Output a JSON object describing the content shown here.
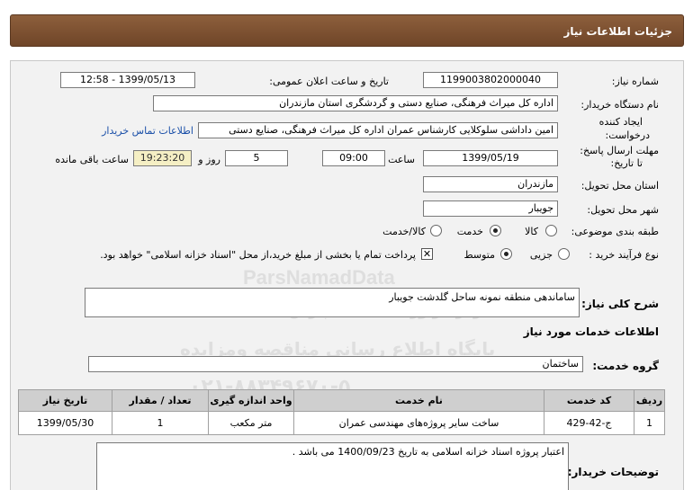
{
  "header": {
    "title": "جزئیات اطلاعات نیاز"
  },
  "fields": {
    "need_number_label": "شماره نیاز:",
    "need_number": "1199003802000040",
    "announce_label": "تاریخ و ساعت اعلان عمومی:",
    "announce_value": "1399/05/13 - 12:58",
    "buyer_label": "نام دستگاه خریدار:",
    "buyer_value": "اداره کل میراث فرهنگی، صنایع دستی و گردشگری استان مازندران",
    "creator_label_1": "ایجاد کننده",
    "creator_label_2": "درخواست:",
    "creator_value": "امین داداشی سلوکلایی کارشناس عمران اداره کل میراث فرهنگی، صنایع دستی",
    "contact_link": "اطلاعات تماس خریدار",
    "deadline_label_1": "مهلت ارسال پاسخ:",
    "deadline_label_2": "تا تاریخ:",
    "deadline_date": "1399/05/19",
    "time_label": "ساعت",
    "deadline_time": "09:00",
    "days_value": "5",
    "days_label": "روز و",
    "remaining_time": "19:23:20",
    "remaining_label": "ساعت باقی مانده",
    "province_label": "استان محل تحویل:",
    "province_value": "مازندران",
    "city_label": "شهر محل تحویل:",
    "city_value": "جویبار",
    "category_label": "طبقه بندی موضوعی:",
    "cat_goods": "کالا",
    "cat_service": "خدمت",
    "cat_goods_service": "کالا/خدمت",
    "process_label": "نوع فرآیند خرید :",
    "proc_minor": "جزیی",
    "proc_medium": "متوسط",
    "payment_note": "پرداخت تمام یا بخشی از مبلغ خرید،از محل \"اسناد خزانه اسلامی\" خواهد بود."
  },
  "summary": {
    "label": "شرح کلی نیاز:",
    "value": "ساماندهی منطقه نمونه ساحل گلدشت جویبار"
  },
  "services_section": {
    "title": "اطلاعات خدمات مورد نیاز",
    "group_label": "گروه خدمت:",
    "group_value": "ساختمان"
  },
  "table": {
    "headers": [
      "ردیف",
      "کد خدمت",
      "نام خدمت",
      "واحد اندازه گیری",
      "تعداد / مقدار",
      "تاریخ نیاز"
    ],
    "rows": [
      [
        "1",
        "ج-42-429",
        "ساخت سایر پروژه‌های مهندسی عمران",
        "متر مکعب",
        "1",
        "1399/05/30"
      ]
    ]
  },
  "buyer_notes": {
    "label": "توضیحات خریدار:",
    "value": "اعتبار پروژه اسناد خزانه اسلامی به تاریخ 1400/09/23 می باشد ."
  },
  "watermark": {
    "line1": "ParsNamadData",
    "line2": "مرکز فراوری اطلاعات پارس نماد داده ها",
    "line3": "پایگاه اطلاع رسانی مناقصه ومزایده",
    "line4": "۰۲۱-۸۸۳۴۹۶۷۰-۵"
  }
}
